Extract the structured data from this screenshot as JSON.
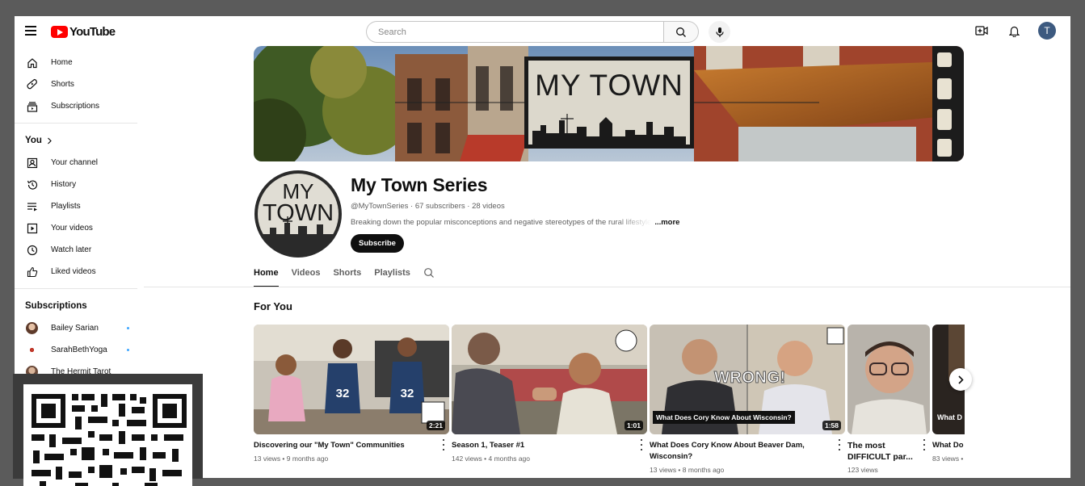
{
  "header": {
    "logo_text": "YouTube",
    "search_placeholder": "Search",
    "avatar_letter": "T"
  },
  "sidebar": {
    "main": [
      {
        "label": "Home",
        "icon": "home-icon"
      },
      {
        "label": "Shorts",
        "icon": "shorts-icon"
      },
      {
        "label": "Subscriptions",
        "icon": "subscriptions-icon"
      }
    ],
    "you_heading": "You",
    "you": [
      {
        "label": "Your channel",
        "icon": "your-channel-icon"
      },
      {
        "label": "History",
        "icon": "history-icon"
      },
      {
        "label": "Playlists",
        "icon": "playlists-icon"
      },
      {
        "label": "Your videos",
        "icon": "your-videos-icon"
      },
      {
        "label": "Watch later",
        "icon": "watch-later-icon"
      },
      {
        "label": "Liked videos",
        "icon": "liked-videos-icon"
      }
    ],
    "subscriptions_heading": "Subscriptions",
    "subscriptions": [
      {
        "label": "Bailey Sarian",
        "new": true,
        "color": "#7a5442"
      },
      {
        "label": "SarahBethYoga",
        "new": true,
        "color": "#c0392b"
      },
      {
        "label": "The Hermit Tarot",
        "new": false,
        "color": "#6b4a3a"
      }
    ]
  },
  "channel": {
    "banner_text": "MY TOWN",
    "avatar_text_line1": "MY",
    "avatar_text_line2": "TOWN",
    "name": "My Town Series",
    "meta": "@MyTownSeries · 67 subscribers · 28 videos",
    "description": "Breaking down the popular misconceptions and negative stereotypes of the rural lifestyle",
    "more_label": "...more",
    "subscribe_label": "Subscribe"
  },
  "tabs": [
    {
      "label": "Home",
      "active": true
    },
    {
      "label": "Videos",
      "active": false
    },
    {
      "label": "Shorts",
      "active": false
    },
    {
      "label": "Playlists",
      "active": false
    }
  ],
  "section_title": "For You",
  "videos": [
    {
      "title": "Discovering our \"My Town\" Communities",
      "meta": "13 views • 9 months ago",
      "duration": "2:21"
    },
    {
      "title": "Season 1, Teaser #1",
      "meta": "142 views • 4 months ago",
      "duration": "1:01"
    },
    {
      "title": "What Does Cory Know About Beaver Dam, Wisconsin?",
      "meta": "13 views • 8 months ago",
      "duration": "1:58",
      "overlay_text": "WRONG!",
      "caption": "What Does Cory Know About Wisconsin?"
    },
    {
      "title": "The most DIFFICULT par...",
      "meta": "123 views"
    },
    {
      "title": "What Do",
      "meta": "83 views •",
      "caption": "What D"
    }
  ],
  "colors": {
    "brand_red": "#ff0000",
    "text_primary": "#0f0f0f",
    "text_secondary": "#606060",
    "avatar_blue": "#3d5a80",
    "new_dot": "#3ea6ff"
  }
}
